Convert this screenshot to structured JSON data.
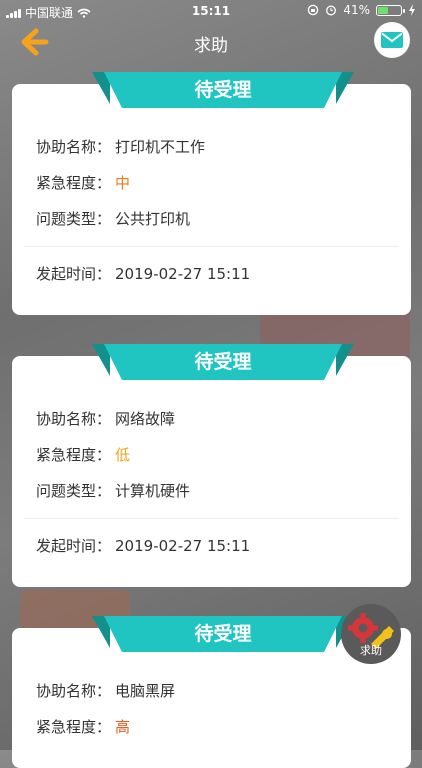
{
  "status_bar": {
    "carrier": "中国联通",
    "time": "15:11",
    "battery": "41%",
    "battery_level": 0.41
  },
  "header": {
    "title": "求助"
  },
  "cards": [
    {
      "status": "待受理",
      "name_label": "协助名称：",
      "name": "打印机不工作",
      "urgency_label": "紧急程度：",
      "urgency": "中",
      "urgency_color": "#f07a1c",
      "type_label": "问题类型：",
      "type": "公共打印机",
      "time_label": "发起时间：",
      "time": "2019-02-27 15:11"
    },
    {
      "status": "待受理",
      "name_label": "协助名称：",
      "name": "网络故障",
      "urgency_label": "紧急程度：",
      "urgency": "低",
      "urgency_color": "#f2a21c",
      "type_label": "问题类型：",
      "type": "计算机硬件",
      "time_label": "发起时间：",
      "time": "2019-02-27 15:11"
    },
    {
      "status": "待受理",
      "name_label": "协助名称：",
      "name": "电脑黑屏",
      "urgency_label": "紧急程度：",
      "urgency": "高",
      "urgency_color": "#f05a1c"
    }
  ],
  "fab": {
    "label": "求助"
  },
  "colors": {
    "accent": "#20c4c0",
    "back_arrow": "#f7a21b"
  }
}
